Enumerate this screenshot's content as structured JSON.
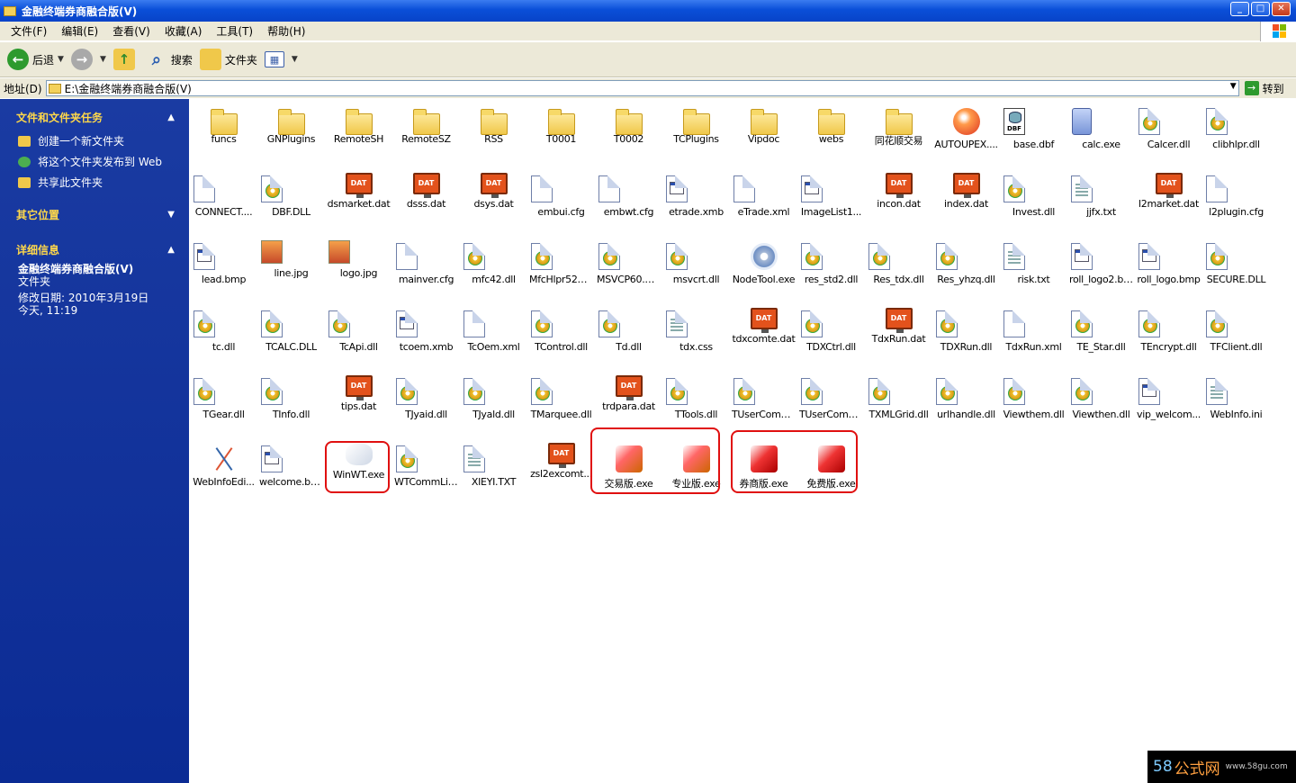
{
  "window": {
    "title": "金融终端券商融合版(V)"
  },
  "menu": [
    "文件(F)",
    "编辑(E)",
    "查看(V)",
    "收藏(A)",
    "工具(T)",
    "帮助(H)"
  ],
  "toolbar": {
    "back": "后退",
    "search": "搜索",
    "folders": "文件夹"
  },
  "address": {
    "label": "地址(D)",
    "value": "E:\\金融终端券商融合版(V)",
    "go": "转到"
  },
  "sidebar": {
    "tasks_title": "文件和文件夹任务",
    "tasks": [
      "创建一个新文件夹",
      "将这个文件夹发布到 Web",
      "共享此文件夹"
    ],
    "other_title": "其它位置",
    "details_title": "详细信息",
    "details_name": "金融终端券商融合版(V)",
    "details_type": "文件夹",
    "details_modified": "修改日期: 2010年3月19日今天, 11:19"
  },
  "files": [
    {
      "name": "funcs",
      "type": "folder"
    },
    {
      "name": "GNPlugins",
      "type": "folder"
    },
    {
      "name": "RemoteSH",
      "type": "folder"
    },
    {
      "name": "RemoteSZ",
      "type": "folder"
    },
    {
      "name": "RSS",
      "type": "folder"
    },
    {
      "name": "T0001",
      "type": "folder"
    },
    {
      "name": "T0002",
      "type": "folder"
    },
    {
      "name": "TCPlugins",
      "type": "folder"
    },
    {
      "name": "Vipdoc",
      "type": "folder"
    },
    {
      "name": "webs",
      "type": "folder"
    },
    {
      "name": "同花顺交易",
      "type": "folder"
    },
    {
      "name": "AUTOUPEX....",
      "type": "orb"
    },
    {
      "name": "base.dbf",
      "type": "db"
    },
    {
      "name": "calc.exe",
      "type": "calc"
    },
    {
      "name": "Calcer.dll",
      "type": "dll"
    },
    {
      "name": "clibhlpr.dll",
      "type": "dll"
    },
    {
      "name": "CONNECT....",
      "type": "page"
    },
    {
      "name": "DBF.DLL",
      "type": "dll"
    },
    {
      "name": "dsmarket.dat",
      "type": "dat"
    },
    {
      "name": "dsss.dat",
      "type": "dat"
    },
    {
      "name": "dsys.dat",
      "type": "dat"
    },
    {
      "name": "embui.cfg",
      "type": "page"
    },
    {
      "name": "embwt.cfg",
      "type": "page"
    },
    {
      "name": "etrade.xmb",
      "type": "win"
    },
    {
      "name": "eTrade.xml",
      "type": "page"
    },
    {
      "name": "ImageList1...",
      "type": "win"
    },
    {
      "name": "incon.dat",
      "type": "dat"
    },
    {
      "name": "index.dat",
      "type": "dat"
    },
    {
      "name": "Invest.dll",
      "type": "dll"
    },
    {
      "name": "jjfx.txt",
      "type": "txt"
    },
    {
      "name": "l2market.dat",
      "type": "dat"
    },
    {
      "name": "l2plugin.cfg",
      "type": "page"
    },
    {
      "name": "lead.bmp",
      "type": "win"
    },
    {
      "name": "line.jpg",
      "type": "jpg"
    },
    {
      "name": "logo.jpg",
      "type": "jpg"
    },
    {
      "name": "mainver.cfg",
      "type": "page"
    },
    {
      "name": "mfc42.dll",
      "type": "dll"
    },
    {
      "name": "MfcHlpr520.dll",
      "type": "dll"
    },
    {
      "name": "MSVCP60.DLL",
      "type": "dll"
    },
    {
      "name": "msvcrt.dll",
      "type": "dll"
    },
    {
      "name": "NodeTool.exe",
      "type": "disc"
    },
    {
      "name": "res_std2.dll",
      "type": "dll"
    },
    {
      "name": "Res_tdx.dll",
      "type": "dll"
    },
    {
      "name": "Res_yhzq.dll",
      "type": "dll"
    },
    {
      "name": "risk.txt",
      "type": "txt"
    },
    {
      "name": "roll_logo2.bmp",
      "type": "win"
    },
    {
      "name": "roll_logo.bmp",
      "type": "win"
    },
    {
      "name": "SECURE.DLL",
      "type": "dll"
    },
    {
      "name": "tc.dll",
      "type": "dll"
    },
    {
      "name": "TCALC.DLL",
      "type": "dll"
    },
    {
      "name": "TcApi.dll",
      "type": "dll"
    },
    {
      "name": "tcoem.xmb",
      "type": "win"
    },
    {
      "name": "TcOem.xml",
      "type": "page"
    },
    {
      "name": "TControl.dll",
      "type": "dll"
    },
    {
      "name": "Td.dll",
      "type": "dll"
    },
    {
      "name": "tdx.css",
      "type": "txt"
    },
    {
      "name": "tdxcomte.dat",
      "type": "dat"
    },
    {
      "name": "TDXCtrl.dll",
      "type": "dll"
    },
    {
      "name": "TdxRun.dat",
      "type": "dat"
    },
    {
      "name": "TDXRun.dll",
      "type": "dll"
    },
    {
      "name": "TdxRun.xml",
      "type": "page"
    },
    {
      "name": "TE_Star.dll",
      "type": "dll"
    },
    {
      "name": "TEncrypt.dll",
      "type": "dll"
    },
    {
      "name": "TFClient.dll",
      "type": "dll"
    },
    {
      "name": "TGear.dll",
      "type": "dll"
    },
    {
      "name": "TInfo.dll",
      "type": "dll"
    },
    {
      "name": "tips.dat",
      "type": "dat"
    },
    {
      "name": "TJyaid.dll",
      "type": "dll"
    },
    {
      "name": "TJyald.dll",
      "type": "dll"
    },
    {
      "name": "TMarquee.dll",
      "type": "dll"
    },
    {
      "name": "trdpara.dat",
      "type": "dat"
    },
    {
      "name": "TTools.dll",
      "type": "dll"
    },
    {
      "name": "TUserComm.dll",
      "type": "dll"
    },
    {
      "name": "TUserComn.dll",
      "type": "dll"
    },
    {
      "name": "TXMLGrid.dll",
      "type": "dll"
    },
    {
      "name": "urlhandle.dll",
      "type": "dll"
    },
    {
      "name": "Viewthem.dll",
      "type": "dll"
    },
    {
      "name": "Viewthen.dll",
      "type": "dll"
    },
    {
      "name": "vip_welcom...",
      "type": "win"
    },
    {
      "name": "WebInfo.ini",
      "type": "txt"
    },
    {
      "name": "WebInfoEdi...",
      "type": "webedit"
    },
    {
      "name": "welcome.bmp",
      "type": "win"
    },
    {
      "name": "WinWT.exe",
      "type": "hands"
    },
    {
      "name": "WTCommLib...",
      "type": "dll"
    },
    {
      "name": "XIEYI.TXT",
      "type": "txt"
    },
    {
      "name": "zsl2excomt...",
      "type": "dat"
    },
    {
      "name": "交易版.exe",
      "type": "exered"
    },
    {
      "name": "专业版.exe",
      "type": "exered"
    },
    {
      "name": "券商版.exe",
      "type": "exered2"
    },
    {
      "name": "免费版.exe",
      "type": "exered2"
    }
  ],
  "watermark": {
    "a": "58",
    "b": "公式网",
    "c": "www.58gu.com"
  }
}
